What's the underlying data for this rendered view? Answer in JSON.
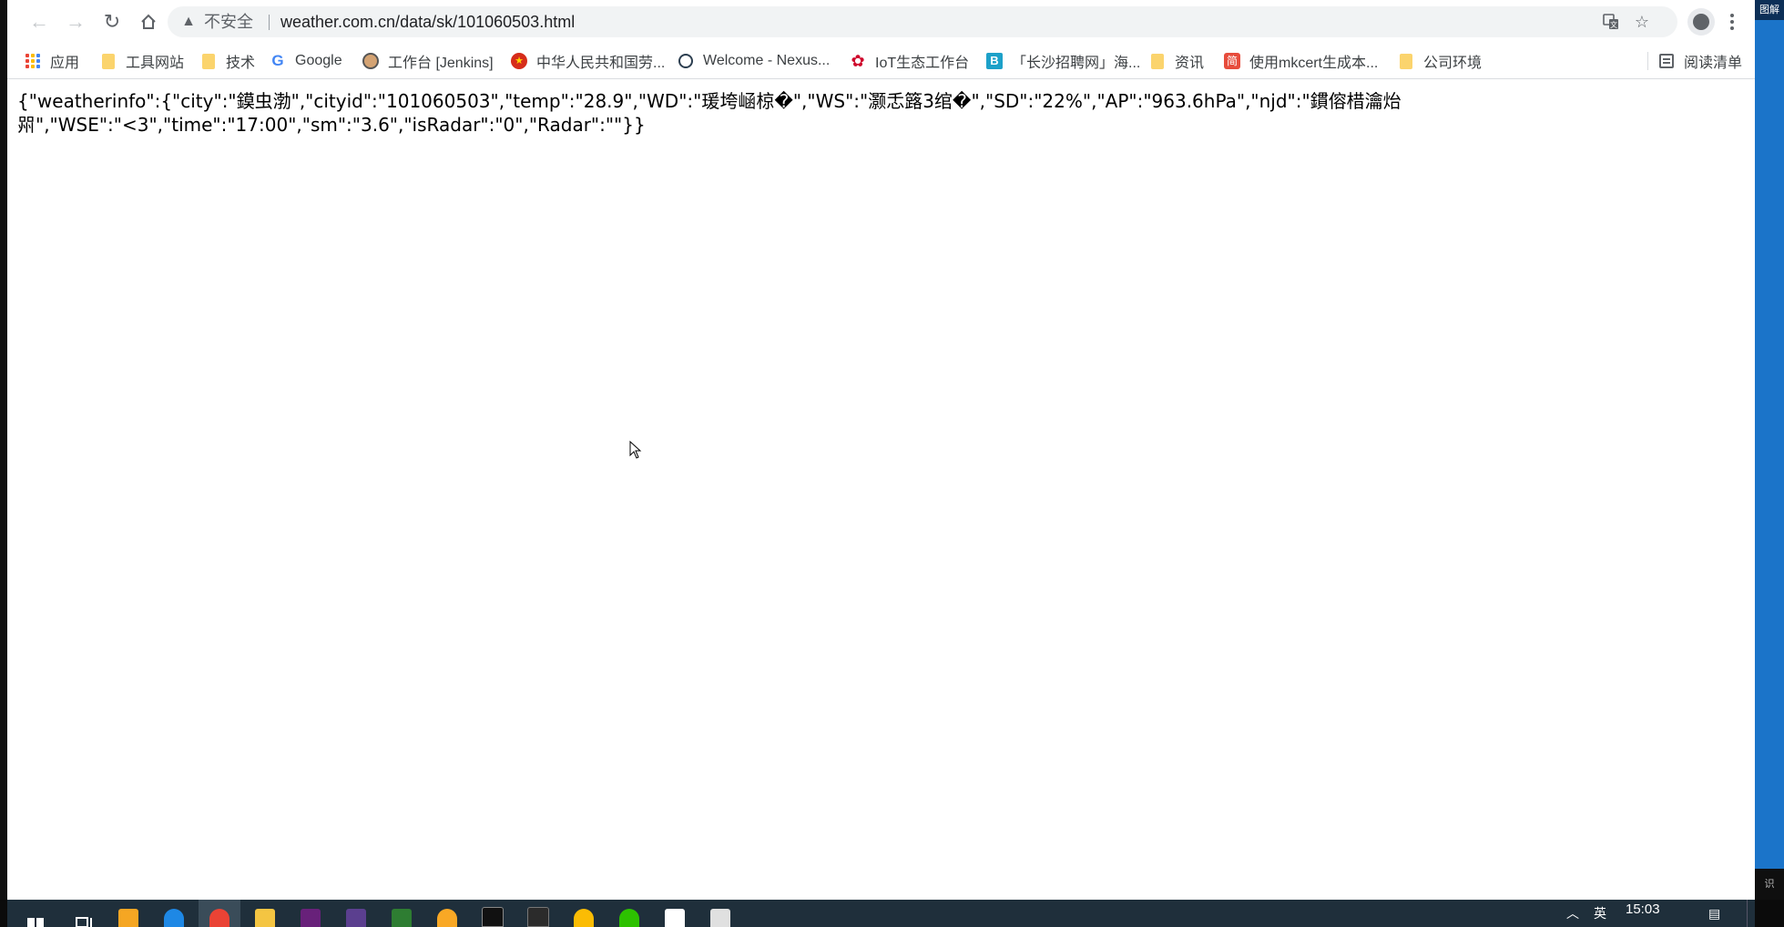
{
  "browser": {
    "security_label": "不安全",
    "url": "weather.com.cn/data/sk/101060503.html"
  },
  "bookmarks": [
    {
      "label": "应用",
      "icon": "apps-grid-icon"
    },
    {
      "label": "工具网站",
      "icon": "folder-icon"
    },
    {
      "label": "技术",
      "icon": "folder-icon"
    },
    {
      "label": "Google",
      "icon": "google-icon"
    },
    {
      "label": "工作台 [Jenkins]",
      "icon": "jenkins-icon"
    },
    {
      "label": "中华人民共和国劳...",
      "icon": "emblem-icon"
    },
    {
      "label": "Welcome - Nexus...",
      "icon": "nexus-icon"
    },
    {
      "label": "IoT生态工作台",
      "icon": "huawei-icon"
    },
    {
      "label": "「长沙招聘网」海...",
      "icon": "b-logo-icon"
    },
    {
      "label": "资讯",
      "icon": "folder-icon"
    },
    {
      "label": "使用mkcert生成本...",
      "icon": "jian-icon"
    },
    {
      "label": "公司环境",
      "icon": "folder-icon"
    }
  ],
  "reading_list_label": "阅读清单",
  "page": {
    "json_text": "{\"weatherinfo\":{\"city\":\"鏌虫渤\",\"cityid\":\"101060503\",\"temp\":\"28.9\",\"WD\":\"瑗垮崡椋�\",\"WS\":\"灏忎簬3绾�\",\"SD\":\"22%\",\"AP\":\"963.6hPa\",\"njd\":\"鏆傛棤瀹炲喌\",\"WSE\":\"<3\",\"time\":\"17:00\",\"sm\":\"3.6\",\"isRadar\":\"0\",\"Radar\":\"\"}}"
  },
  "taskbar": {
    "clock": "15:03",
    "ime": "英"
  },
  "desktop": {
    "edge_top_text": "图解",
    "edge_bottom_text": "识"
  },
  "colors": {
    "taskbar_bg": "#1f2f3b",
    "omnibox_bg": "#f1f3f4",
    "desktop_edge": "#1b74c9"
  }
}
